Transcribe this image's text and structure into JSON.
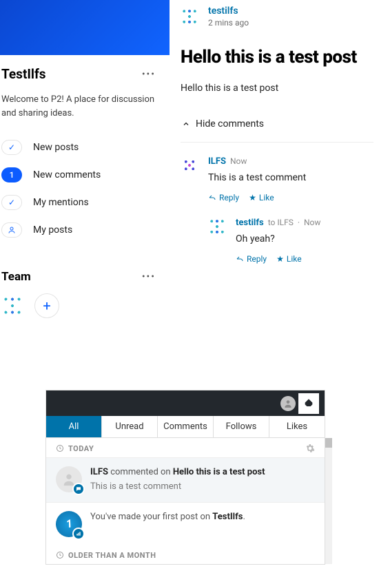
{
  "sidebar": {
    "title": "TestIlfs",
    "description": "Welcome to P2! A place for discussion and sharing ideas.",
    "filters": {
      "new_posts": "New posts",
      "new_comments": "New comments",
      "new_comments_count": "1",
      "my_mentions": "My mentions",
      "my_posts": "My posts"
    },
    "team": {
      "title": "Team"
    }
  },
  "post": {
    "author": "testilfs",
    "time": "2 mins ago",
    "title": "Hello this is a test post",
    "body": "Hello this is a test post",
    "hide_comments": "Hide comments"
  },
  "comments": [
    {
      "author": "ILFS",
      "time": "Now",
      "body": "This is a test comment",
      "reply_label": "Reply",
      "like_label": "Like"
    },
    {
      "author": "testilfs",
      "to_label": "to ILFS",
      "time": "Now",
      "body": "Oh yeah?",
      "reply_label": "Reply",
      "like_label": "Like"
    }
  ],
  "notif": {
    "tabs": {
      "all": "All",
      "unread": "Unread",
      "comments": "Comments",
      "follows": "Follows",
      "likes": "Likes"
    },
    "today": "TODAY",
    "older": "OLDER THAN A MONTH",
    "item1": {
      "actor": "ILFS",
      "verb": " commented on ",
      "target": "Hello this is a test post",
      "sub": "This is a test comment"
    },
    "item2": {
      "prefix": "You've made your first post on ",
      "target": "TestIlfs",
      "suffix": ".",
      "badge": "1"
    }
  }
}
